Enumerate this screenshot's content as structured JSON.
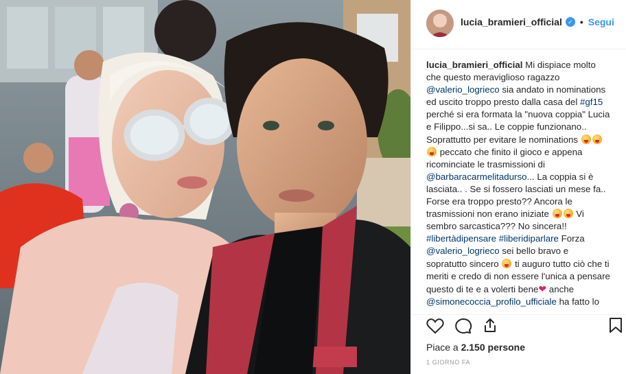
{
  "header": {
    "username": "lucia_bramieri_official",
    "follow_label": "Segui",
    "separator": "•"
  },
  "caption": {
    "username": "lucia_bramieri_official",
    "p1": " Mi dispiace molto che questo meraviglioso ragazzo ",
    "m1": "@valerio_logrieco",
    "p2": " sia andato in nominations ed uscito troppo presto dalla casa del ",
    "h1": "#gf15",
    "p3": " perché si era formata la \"nuova coppia\" Lucia e Filippo...si sa.. Le coppie funzionano.. Soprattutto per evitare le nominations ",
    "p4": " peccato che finito il gioco e appena ricominciate le trasmissioni di ",
    "m2": "@barbaracarmelitadurso",
    "p5": "... La coppia si è lasciata.. . Se si fossero lasciati un mese fa.. Forse era troppo presto?? Ancora le trasmissioni non erano iniziate ",
    "p6": " Vi sembro sarcastica??? No sincera!! ",
    "h2": "#libertàdipensare",
    "h3": "#liberidiparlare",
    "p7": " Forza ",
    "m3": "@valerio_logrieco",
    "p8": " sei bello bravo e sopratutto sincero ",
    "p9": " ti auguro tutto ciò che ti meriti e credo di non essere l'unica a pensare questo di te e a volerti bene",
    "p10": " anche ",
    "m4": "@simonecoccia_profilo_ufficiale",
    "p11": " ha fatto lo stesso e ci auguriamo Grazie Valerio"
  },
  "actions": {
    "like_icon": "heart-outline-icon",
    "comment_icon": "comment-icon",
    "share_icon": "share-icon",
    "save_icon": "bookmark-icon",
    "likes_prefix": "Piace a ",
    "likes_count": "2.150",
    "likes_suffix": " persone",
    "timestamp": "1 GIORNO FA"
  },
  "colors": {
    "link": "#003569",
    "follow": "#3897f0",
    "verified": "#3897f0",
    "text": "#262626",
    "muted": "#999999",
    "border": "#efefef"
  }
}
